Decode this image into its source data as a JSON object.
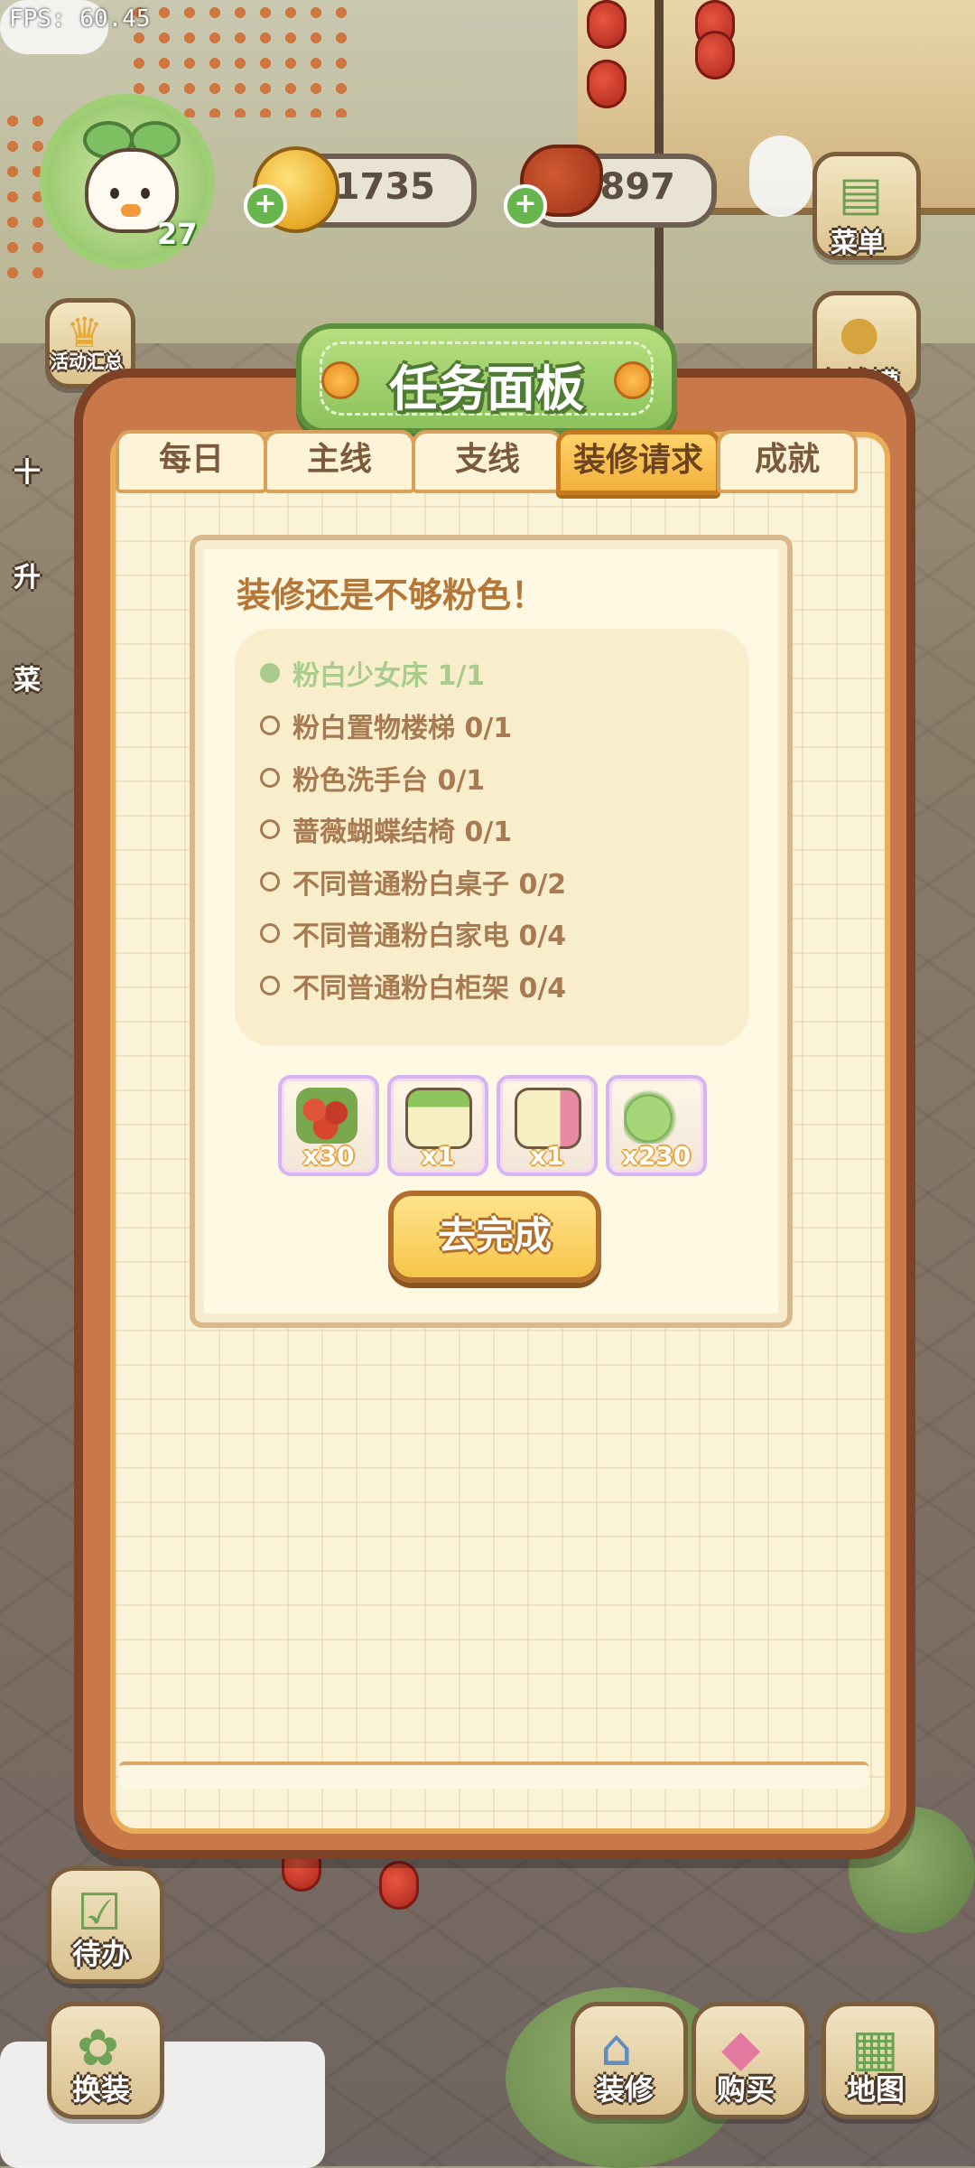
{
  "fps": "FPS: 60.45",
  "player": {
    "level": "27"
  },
  "currency": {
    "coins": "1735",
    "meat": "897"
  },
  "side_buttons": {
    "menu": "菜单",
    "events": "活动汇总",
    "bank": "存钱罐",
    "left_partial_1": "十",
    "left_partial_2": "升",
    "left_partial_3": "菜"
  },
  "panel": {
    "title": "任务面板",
    "tabs": [
      "每日",
      "主线",
      "支线",
      "装修请求",
      "成就"
    ],
    "active_tab": "装修请求"
  },
  "task": {
    "title": "装修还是不够粉色！",
    "requirements": [
      {
        "label": "粉白少女床 1/1",
        "done": true
      },
      {
        "label": "粉白置物楼梯 0/1",
        "done": false
      },
      {
        "label": "粉色洗手台 0/1",
        "done": false
      },
      {
        "label": "蔷薇蝴蝶结椅 0/1",
        "done": false
      },
      {
        "label": "不同普通粉白桌子 0/2",
        "done": false
      },
      {
        "label": "不同普通粉白家电 0/4",
        "done": false
      },
      {
        "label": "不同普通粉白柜架 0/4",
        "done": false
      }
    ],
    "rewards": [
      {
        "icon": "berries-icon",
        "qty": "x30"
      },
      {
        "icon": "sprout-card-icon",
        "qty": "x1"
      },
      {
        "icon": "crown-card-icon",
        "qty": "x1"
      },
      {
        "icon": "leaf-exp-icon",
        "qty": "x230"
      }
    ],
    "go_button": "去完成"
  },
  "bottom_buttons": {
    "todo": "待办",
    "outfit": "换装",
    "decorate": "装修",
    "shop": "购买",
    "map": "地图"
  },
  "colors": {
    "panel_frame": "#c9784a",
    "title_banner": "#8cc25c",
    "active_tab": "#f2b03a",
    "done_text": "#a9cc8d",
    "pending_text": "#a77a52"
  }
}
